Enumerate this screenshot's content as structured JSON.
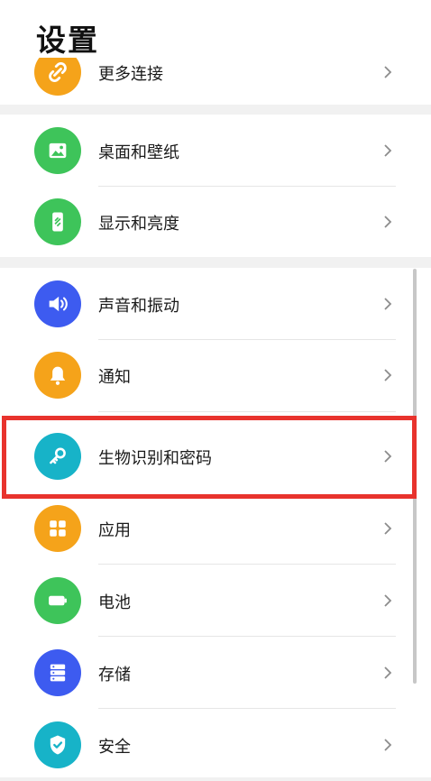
{
  "header": {
    "title": "设置"
  },
  "colors": {
    "orange": "#f5a31a",
    "green": "#3ec45a",
    "blue": "#3d5bf0",
    "cyan": "#17b3c8",
    "highlight": "#e8332d"
  },
  "rows": {
    "more_connections": {
      "label": "更多连接",
      "icon": "link-icon"
    },
    "desktop_wallpaper": {
      "label": "桌面和壁纸",
      "icon": "image-icon"
    },
    "display_brightness": {
      "label": "显示和亮度",
      "icon": "phone-brightness-icon"
    },
    "sound_vibration": {
      "label": "声音和振动",
      "icon": "speaker-icon"
    },
    "notifications": {
      "label": "通知",
      "icon": "bell-icon"
    },
    "biometrics_password": {
      "label": "生物识别和密码",
      "icon": "key-icon"
    },
    "apps": {
      "label": "应用",
      "icon": "apps-grid-icon"
    },
    "battery": {
      "label": "电池",
      "icon": "battery-icon"
    },
    "storage": {
      "label": "存储",
      "icon": "storage-icon"
    },
    "security": {
      "label": "安全",
      "icon": "shield-icon"
    }
  }
}
